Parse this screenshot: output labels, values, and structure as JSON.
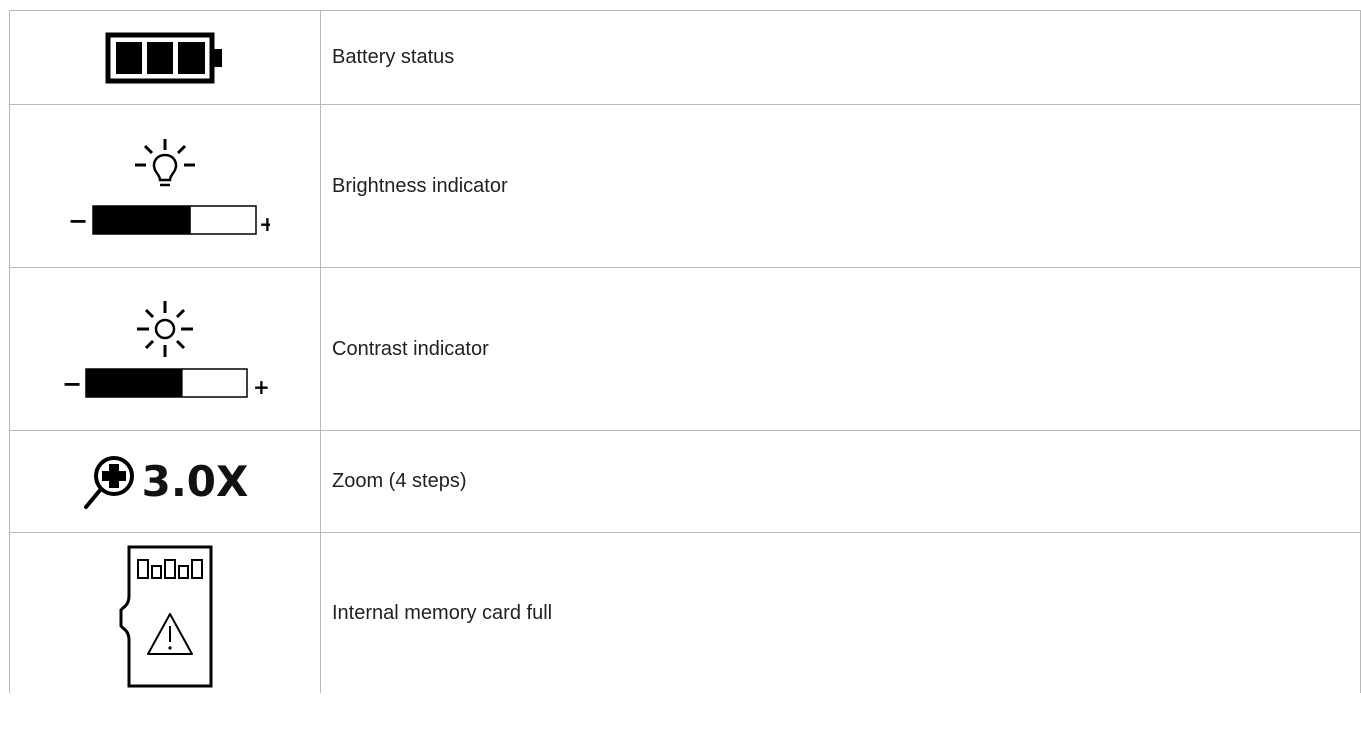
{
  "rows": [
    {
      "icon": "battery-icon",
      "label": "Battery status"
    },
    {
      "icon": "brightness-bulb-icon",
      "label": "Brightness indicator",
      "level": 0.6,
      "minus": "−",
      "plus": "+"
    },
    {
      "icon": "contrast-sun-icon",
      "label": "Contrast indicator",
      "level": 0.6,
      "minus": "−",
      "plus": "+"
    },
    {
      "icon": "zoom-magnifier-icon",
      "label": "Zoom (4 steps)",
      "value": "3.0X"
    },
    {
      "icon": "memory-card-warning-icon",
      "label": "Internal memory card full"
    }
  ]
}
